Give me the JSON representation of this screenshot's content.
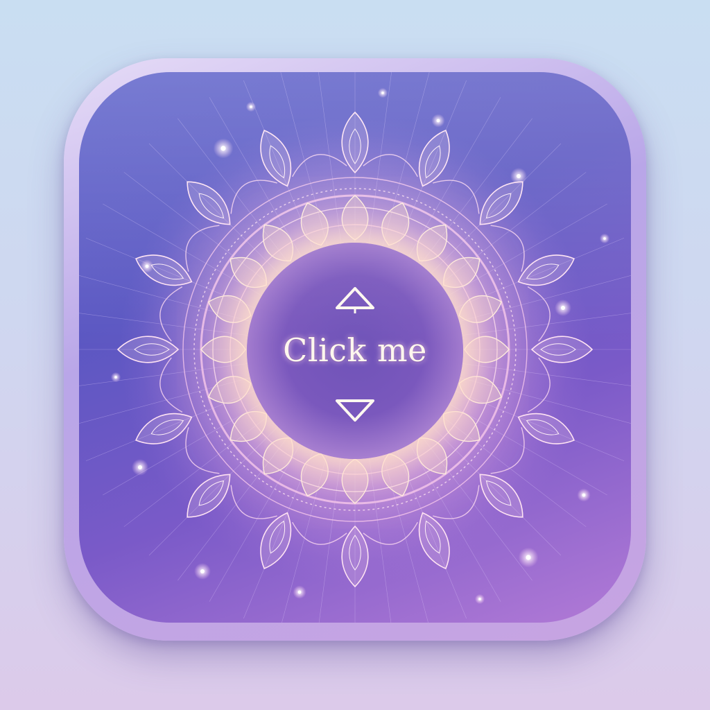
{
  "button": {
    "label": "Click me"
  },
  "icons": {
    "top": "triangle-up-icon",
    "bottom": "triangle-down-icon",
    "decoration": "mandala-icon"
  },
  "colors": {
    "background_top": "#c9def2",
    "background_bottom": "#dccaea",
    "tile_blue": "#5a5fc9",
    "tile_purple": "#b27ad6",
    "glow": "#ffe1c8",
    "text": "#fff7ee"
  }
}
